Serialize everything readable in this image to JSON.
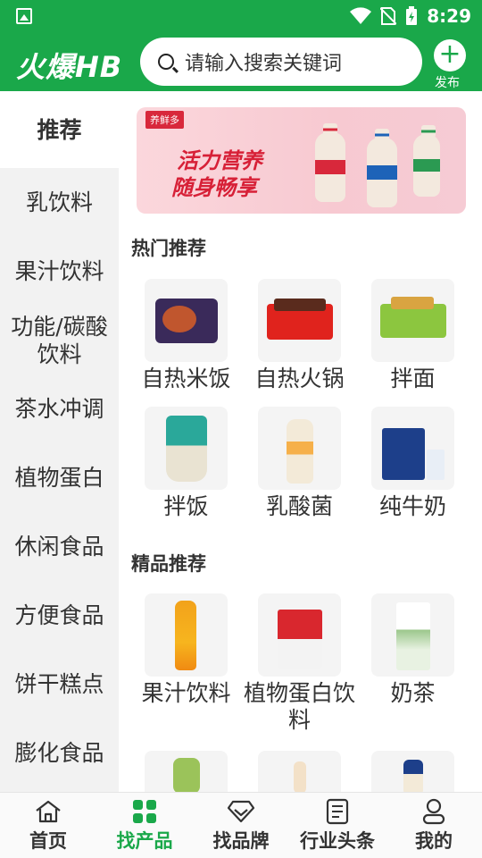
{
  "status_bar": {
    "time": "8:29"
  },
  "header": {
    "logo": "火爆HB",
    "search_placeholder": "请输入搜索关键词",
    "publish_label": "发布"
  },
  "sidebar": {
    "items": [
      {
        "label": "推荐",
        "active": true
      },
      {
        "label": "乳饮料"
      },
      {
        "label": "果汁饮料"
      },
      {
        "label": "功能/碳酸饮料"
      },
      {
        "label": "茶水冲调"
      },
      {
        "label": "植物蛋白"
      },
      {
        "label": "休闲食品"
      },
      {
        "label": "方便食品"
      },
      {
        "label": "饼干糕点"
      },
      {
        "label": "膨化食品"
      }
    ]
  },
  "banner": {
    "brand": "养鲜多",
    "slogan_line1": "活力营养",
    "slogan_line2": "随身畅享"
  },
  "hot_section": {
    "title": "热门推荐",
    "products": [
      {
        "name": "自热米饭"
      },
      {
        "name": "自热火锅"
      },
      {
        "name": "拌面"
      },
      {
        "name": "拌饭"
      },
      {
        "name": "乳酸菌"
      },
      {
        "name": "纯牛奶"
      }
    ]
  },
  "premium_section": {
    "title": "精品推荐",
    "products": [
      {
        "name": "果汁饮料"
      },
      {
        "name": "植物蛋白饮料"
      },
      {
        "name": "奶茶"
      }
    ]
  },
  "tabbar": {
    "items": [
      {
        "label": "首页",
        "icon": "home-icon"
      },
      {
        "label": "找产品",
        "icon": "grid-icon",
        "active": true
      },
      {
        "label": "找品牌",
        "icon": "diamond-icon"
      },
      {
        "label": "行业头条",
        "icon": "news-icon"
      },
      {
        "label": "我的",
        "icon": "person-icon"
      }
    ]
  },
  "colors": {
    "brand_green": "#1aa84a",
    "banner_red": "#d72037"
  }
}
